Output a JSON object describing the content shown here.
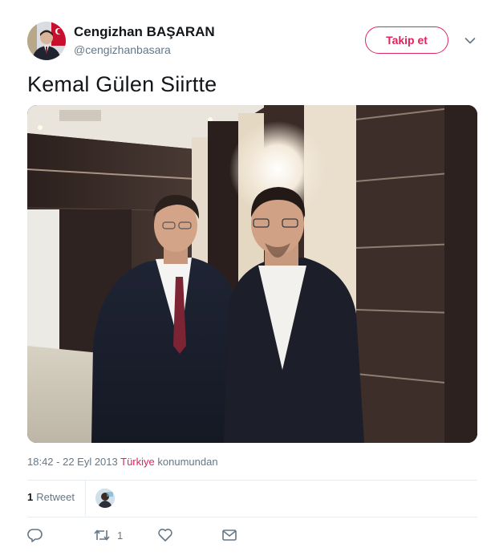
{
  "tweet": {
    "author": {
      "name": "Cengizhan BAŞARAN",
      "handle": "@cengizhanbasara"
    },
    "follow_label": "Takip et",
    "text": "Kemal Gülen Siirtte",
    "timestamp": "18:42 - 22 Eyl 2013",
    "location": "Türkiye",
    "location_suffix": "konumundan",
    "stats": {
      "retweet_count": "1",
      "retweet_label": "Retweet"
    },
    "actions": {
      "reply_icon": "reply-icon",
      "retweet_icon": "retweet-icon",
      "retweet_count": "1",
      "like_icon": "heart-icon",
      "dm_icon": "envelope-icon"
    },
    "colors": {
      "accent": "#e0245e",
      "secondary_text": "#657786",
      "primary_text": "#14171a",
      "divider": "#e6ecf0"
    }
  }
}
